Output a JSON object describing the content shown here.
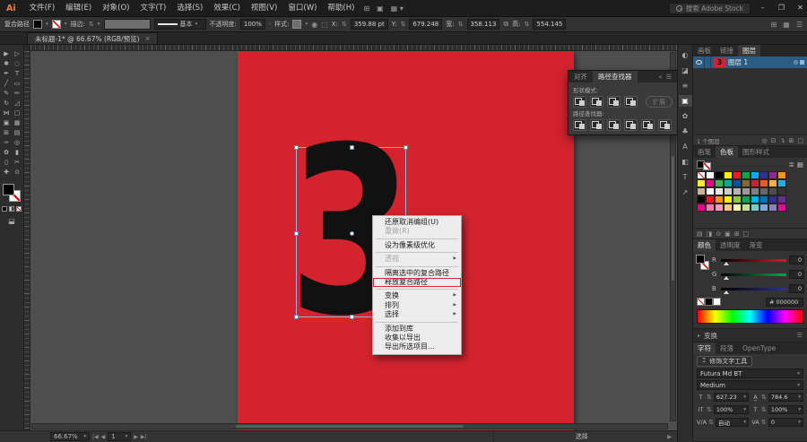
{
  "titlebar": {
    "logo": "Ai",
    "menus": [
      "文件(F)",
      "编辑(E)",
      "对象(O)",
      "文字(T)",
      "选择(S)",
      "效果(C)",
      "视图(V)",
      "窗口(W)",
      "帮助(H)"
    ],
    "search_placeholder": "搜索 Adobe Stock",
    "minimize": "–",
    "maximize": "❐",
    "close": "✕"
  },
  "options_bar": {
    "context_label": "复合路径",
    "stroke_label": "描边:",
    "brush_name": "基本",
    "opacity_label": "不透明度:",
    "opacity_value": "100%",
    "style_label": "样式:",
    "x_label": "X:",
    "x_value": "359.88 pt",
    "y_label": "Y:",
    "y_value": "679.248",
    "w_label": "宽:",
    "w_value": "358.113",
    "h_label": "高:",
    "h_value": "554.145"
  },
  "document_tab": {
    "title": "未标题-1* @ 66.67% (RGB/预览)",
    "close": "×"
  },
  "toolbar": {
    "tools": [
      {
        "name": "selection-tool-icon",
        "glyph": "▶"
      },
      {
        "name": "direct-selection-tool-icon",
        "glyph": "▷"
      },
      {
        "name": "magic-wand-tool-icon",
        "glyph": "✱"
      },
      {
        "name": "lasso-tool-icon",
        "glyph": "◌"
      },
      {
        "name": "pen-tool-icon",
        "glyph": "✒"
      },
      {
        "name": "type-tool-icon",
        "glyph": "T"
      },
      {
        "name": "line-tool-icon",
        "glyph": "╱"
      },
      {
        "name": "rectangle-tool-icon",
        "glyph": "▭"
      },
      {
        "name": "paintbrush-tool-icon",
        "glyph": "✎"
      },
      {
        "name": "pencil-tool-icon",
        "glyph": "✏"
      },
      {
        "name": "rotate-tool-icon",
        "glyph": "↻"
      },
      {
        "name": "scale-tool-icon",
        "glyph": "◿"
      },
      {
        "name": "width-tool-icon",
        "glyph": "⋈"
      },
      {
        "name": "free-transform-tool-icon",
        "glyph": "▢"
      },
      {
        "name": "shape-builder-tool-icon",
        "glyph": "▣"
      },
      {
        "name": "perspective-grid-tool-icon",
        "glyph": "▦"
      },
      {
        "name": "mesh-tool-icon",
        "glyph": "⊞"
      },
      {
        "name": "gradient-tool-icon",
        "glyph": "▤"
      },
      {
        "name": "eyedropper-tool-icon",
        "glyph": "✑"
      },
      {
        "name": "blend-tool-icon",
        "glyph": "◎"
      },
      {
        "name": "symbol-sprayer-tool-icon",
        "glyph": "✿"
      },
      {
        "name": "graph-tool-icon",
        "glyph": "▮"
      },
      {
        "name": "artboard-tool-icon",
        "glyph": "▯"
      },
      {
        "name": "slice-tool-icon",
        "glyph": "✂"
      },
      {
        "name": "hand-tool-icon",
        "glyph": "✚"
      },
      {
        "name": "zoom-tool-icon",
        "glyph": "⊙"
      }
    ]
  },
  "canvas": {
    "glyph": "3"
  },
  "context_menu": {
    "items": [
      {
        "label": "还原取消编组(U)"
      },
      {
        "label": "重做(R)",
        "disabled": true
      },
      {
        "sep": true
      },
      {
        "label": "设为像素级优化"
      },
      {
        "sep": true
      },
      {
        "label": "透视",
        "disabled": true,
        "submenu": true
      },
      {
        "sep": true
      },
      {
        "label": "隔离选中的复合路径"
      },
      {
        "label": "释放复合路径",
        "highlighted": true
      },
      {
        "sep": true
      },
      {
        "label": "变换",
        "submenu": true
      },
      {
        "label": "排列",
        "submenu": true
      },
      {
        "label": "选择",
        "submenu": true
      },
      {
        "sep": true
      },
      {
        "label": "添加到库"
      },
      {
        "label": "收集以导出"
      },
      {
        "label": "导出所选项目…"
      }
    ]
  },
  "pathfinder_panel": {
    "tabs": [
      "对齐",
      "路径查找器"
    ],
    "shape_modes_label": "形状模式:",
    "expand_label": "扩展",
    "pathfinders_label": "路径查找器:",
    "shape_mode_buttons": [
      {
        "name": "unite-button"
      },
      {
        "name": "minus-front-button"
      },
      {
        "name": "intersect-button"
      },
      {
        "name": "exclude-button"
      }
    ],
    "pathfinder_buttons": [
      {
        "name": "divide-button"
      },
      {
        "name": "trim-button"
      },
      {
        "name": "merge-button"
      },
      {
        "name": "crop-button"
      },
      {
        "name": "outline-button"
      },
      {
        "name": "minus-back-button"
      }
    ]
  },
  "dock_icons": [
    {
      "name": "info-panel-icon",
      "glyph": "◐"
    },
    {
      "name": "libraries-panel-icon",
      "glyph": "◪"
    },
    {
      "name": "align-panel-icon",
      "glyph": "≡"
    },
    {
      "name": "pathfinder-panel-icon",
      "glyph": "▣"
    },
    {
      "name": "brushes-panel-icon",
      "glyph": "✿"
    },
    {
      "name": "symbols-panel-icon",
      "glyph": "♣"
    },
    {
      "name": "character-styles-panel-icon",
      "glyph": "A"
    },
    {
      "name": "graphic-styles-panel-icon",
      "glyph": "◧"
    },
    {
      "name": "glyphs-panel-icon",
      "glyph": "T"
    },
    {
      "name": "export-panel-icon",
      "glyph": "↗"
    }
  ],
  "layers_panel": {
    "tabs": [
      "画板",
      "链接",
      "图层"
    ],
    "layer_name": "图层 1",
    "thumb_glyph": "3",
    "count_label": "1 个图层",
    "bottom_icons": [
      {
        "name": "locate-object-icon",
        "glyph": "◎"
      },
      {
        "name": "make-mask-icon",
        "glyph": "⊡"
      },
      {
        "name": "new-sublayer-icon",
        "glyph": "↴"
      },
      {
        "name": "new-layer-icon",
        "glyph": "⊞"
      },
      {
        "name": "delete-layer-icon",
        "glyph": "□"
      }
    ]
  },
  "swatches_panel": {
    "tabs": [
      "画笔",
      "色板",
      "图形样式"
    ],
    "swatches": [
      "none",
      "#ffffff",
      "#000000",
      "#fff200",
      "#ed1c24",
      "#00a651",
      "#00aeef",
      "#2e3192",
      "#92278f",
      "#f7941d",
      "#f9ed32",
      "#ec008c",
      "#39b54a",
      "#00a99d",
      "#0054a6",
      "#8c6239",
      "#c1272d",
      "#f15a24",
      "#fbb03b",
      "#29abe2",
      "#c7b299",
      "#ffffff",
      "#e6e6e6",
      "#cccccc",
      "#b3b3b3",
      "#999999",
      "#808080",
      "#666666",
      "#4d4d4d",
      "#333333",
      "#000000",
      "#ed1c24",
      "#f7941d",
      "#fff200",
      "#8dc63f",
      "#00a651",
      "#00aeef",
      "#0072bc",
      "#2e3192",
      "#662d91",
      "#ec008c",
      "#ff7bac",
      "#f49ac1",
      "#fdc689",
      "#fff9ae",
      "#c4df9b",
      "#7accc8",
      "#7da7d9",
      "#8781bd",
      "#ff0099"
    ],
    "bottom_icons": [
      {
        "name": "swatch-libraries-icon",
        "glyph": "▤"
      },
      {
        "name": "swatch-kinds-icon",
        "glyph": "◨"
      },
      {
        "name": "swatch-options-icon",
        "glyph": "⊙"
      },
      {
        "name": "new-color-group-icon",
        "glyph": "▣"
      },
      {
        "name": "new-swatch-icon",
        "glyph": "⊞"
      },
      {
        "name": "delete-swatch-icon",
        "glyph": "□"
      }
    ]
  },
  "color_panel": {
    "tabs": [
      "颜色",
      "透明度",
      "渐变"
    ],
    "sliders": [
      {
        "label": "R",
        "value": "0",
        "color": "#e8112d"
      },
      {
        "label": "G",
        "value": "0",
        "color": "#00a651"
      },
      {
        "label": "B",
        "value": "0",
        "color": "#2e3192"
      }
    ],
    "hex_label": "#",
    "hex": "000000"
  },
  "transform_panel": {
    "label": "变换"
  },
  "character_panel": {
    "tabs": [
      "字符",
      "段落",
      "OpenType"
    ],
    "touch_tool_label": "修饰文字工具",
    "font_name": "Futura Md BT",
    "font_style": "Medium",
    "size_value": "627.23",
    "leading_value": "784.6",
    "v_scale_value": "100%",
    "h_scale_value": "100%",
    "kerning_value": "自动",
    "tracking_value": "0"
  },
  "status_bar": {
    "zoom_value": "66.67%",
    "artboard_value": "1",
    "status_text": "选择"
  },
  "colors": {
    "artboard_red": "#d2232e",
    "highlight_red": "#d9262e",
    "selection_blue": "#9db4d2",
    "layer_row_blue": "#2a5c84"
  }
}
